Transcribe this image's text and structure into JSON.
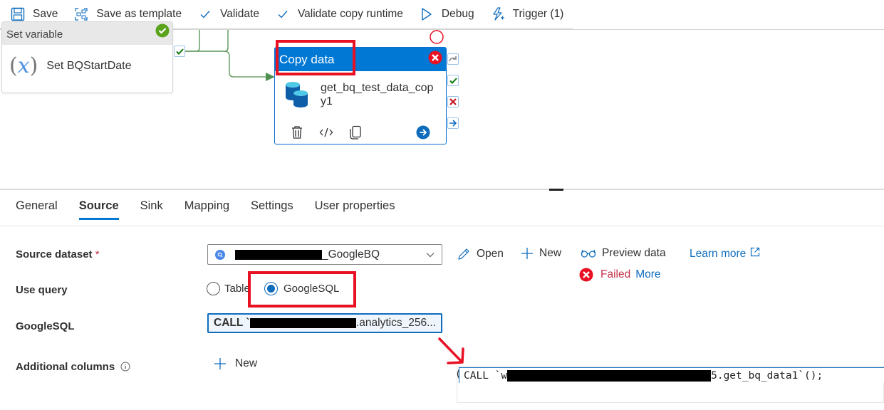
{
  "toolbar": {
    "save": "Save",
    "save_as_template": "Save as template",
    "validate": "Validate",
    "validate_copy_runtime": "Validate copy runtime",
    "debug": "Debug",
    "trigger": "Trigger (1)"
  },
  "canvas": {
    "set_variable": {
      "type_label": "Set variable",
      "name": "Set BQStartDate",
      "status": "succeeded"
    },
    "copy_activity": {
      "type_label": "Copy data",
      "name": "get_bq_test_data_copy1",
      "status": "error"
    }
  },
  "tabs": [
    {
      "label": "General",
      "active": false
    },
    {
      "label": "Source",
      "active": true
    },
    {
      "label": "Sink",
      "active": false
    },
    {
      "label": "Mapping",
      "active": false
    },
    {
      "label": "Settings",
      "active": false
    },
    {
      "label": "User properties",
      "active": false
    }
  ],
  "source": {
    "dataset_label": "Source dataset",
    "required_mark": "*",
    "dataset_value_suffix": "_GoogleBQ",
    "open": "Open",
    "new": "New",
    "preview_data": "Preview data",
    "learn_more": "Learn more",
    "preview_status": "Failed",
    "preview_more": "More",
    "use_query_label": "Use query",
    "use_query_options": [
      "Table",
      "GoogleSQL"
    ],
    "use_query_selected": "GoogleSQL",
    "googlesql_label": "GoogleSQL",
    "googlesql_prefix": "CALL `",
    "googlesql_suffix": ".analytics_256...",
    "additional_columns_label": "Additional columns",
    "additional_columns_new": "New"
  },
  "code_popup": {
    "prefix": "(",
    "start": "CALL `w",
    "end": "5.get_bq_data1`();"
  },
  "colors": {
    "accent": "#0078d4",
    "error": "#e81123",
    "success": "#107c10",
    "annotation": "#e81123"
  }
}
